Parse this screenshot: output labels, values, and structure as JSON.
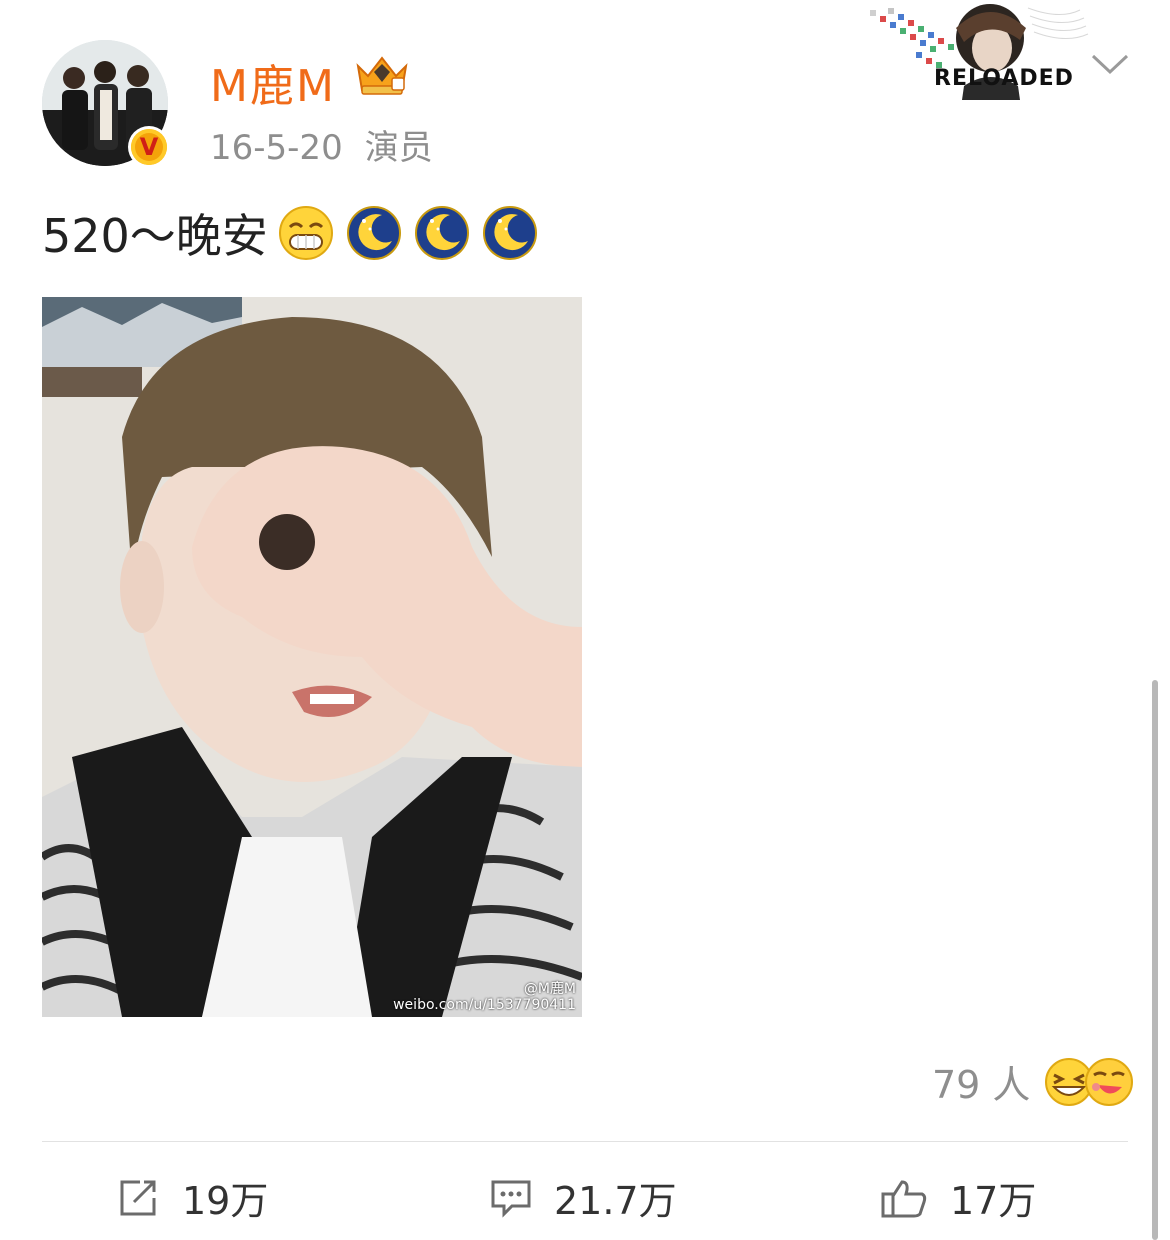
{
  "user": {
    "name": "M鹿M",
    "date": "16-5-20",
    "source": "演员",
    "verified_badge": "V"
  },
  "header_card": {
    "label": "RELOADED",
    "overlay_text": "RELOADED"
  },
  "post": {
    "text": "520～晚安",
    "emoji_icons": [
      "grinning-face-icon",
      "moon-icon",
      "moon-icon",
      "moon-icon"
    ],
    "image_watermark_handle": "@M鹿M",
    "image_watermark_url": "weibo.com/u/1537790411"
  },
  "reactions": {
    "count_label": "79 人",
    "faces": [
      "laughing-face-icon",
      "kissing-face-icon"
    ]
  },
  "actions": {
    "repost": "19万",
    "comment": "21.7万",
    "like": "17万"
  },
  "colors": {
    "username": "#f06b19",
    "meta": "#8e8e8e",
    "accent_badge": "#f4a30a"
  }
}
